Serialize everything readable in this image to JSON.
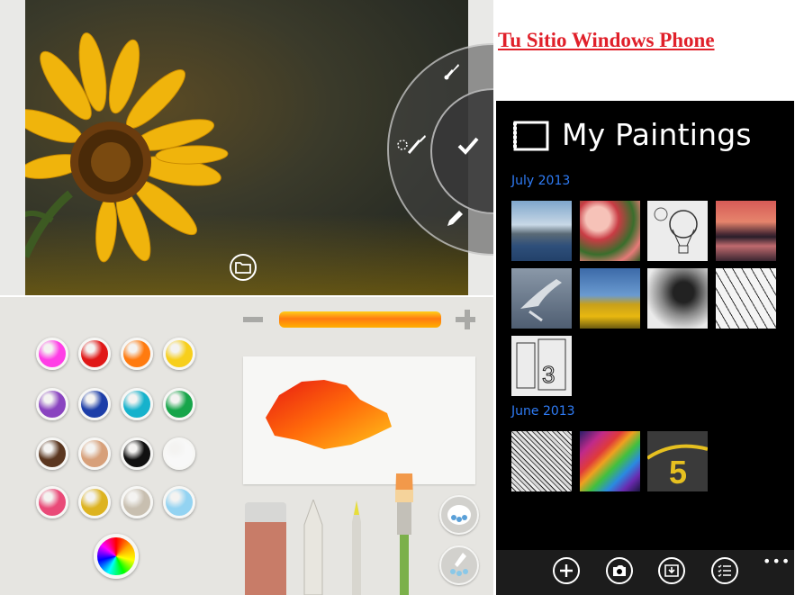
{
  "site_title": "Tu Sitio Windows Phone",
  "editor": {
    "radial_menu_items": [
      "brush-icon",
      "lasso-brush-icon",
      "checkmark-icon",
      "pencil-icon"
    ],
    "folder_icon": "folder-icon"
  },
  "paint": {
    "swatches": [
      "#ff3ee6",
      "#e01818",
      "#ff7b10",
      "#f7cf1c",
      "#8a44c0",
      "#1d3ea8",
      "#16b2cc",
      "#17a54a",
      "#5b3720",
      "#d7a07a",
      "#111111",
      "#f8f8f8",
      "#e94a78",
      "#ddb320",
      "#c8bfb0",
      "#93d3f2"
    ],
    "color_wheel_icon": "color-wheel-icon",
    "size_minus_icon": "minus-icon",
    "size_plus_icon": "plus-icon",
    "tools": [
      "eraser-icon",
      "chalk-icon",
      "pencil-icon",
      "paintbrush-icon"
    ],
    "side_buttons": [
      "palette-icon",
      "brush-wash-icon"
    ]
  },
  "phone": {
    "title": "My Paintings",
    "title_icon": "frame-icon",
    "sections": [
      {
        "label": "July 2013",
        "thumbs": [
          "coastline",
          "pink flowers",
          "hot air balloon sketch",
          "sunset lake",
          "bird in flight",
          "sunflower field",
          "dandelion",
          "boats sketch",
          "building number sketch"
        ]
      },
      {
        "label": "June 2013",
        "thumbs": [
          "city sketch",
          "rainbow stripes",
          "number five road"
        ]
      }
    ],
    "appbar": [
      "add-icon",
      "camera-icon",
      "save-picture-icon",
      "select-list-icon"
    ],
    "more": "•••"
  },
  "colors": {
    "site_title": "#e0202a",
    "section_label": "#2f7cf6",
    "phone_bg": "#000000"
  }
}
